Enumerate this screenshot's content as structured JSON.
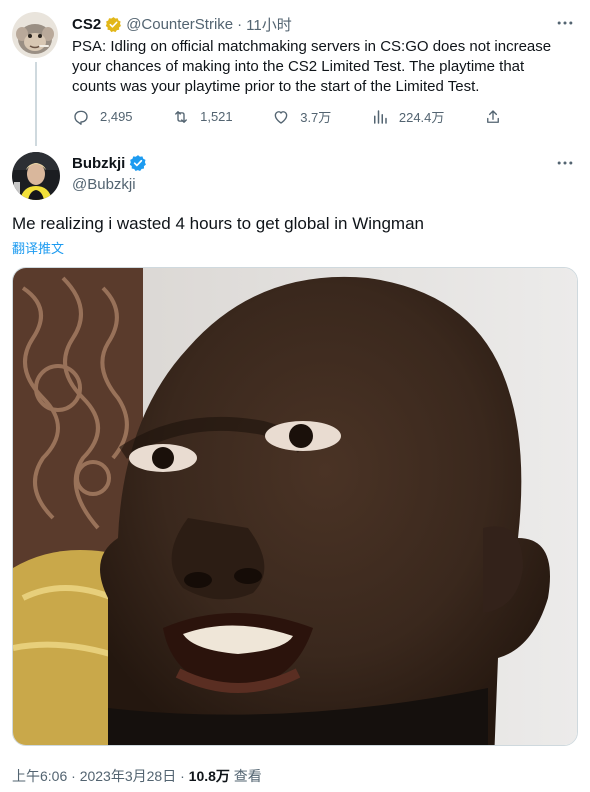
{
  "parent_tweet": {
    "name": "CS2",
    "handle": "@CounterStrike",
    "separator": "·",
    "time": "11小时",
    "text": "PSA: Idling on official matchmaking servers in CS:GO does not increase your chances of making into the CS2 Limited Test. The playtime that counts was your playtime prior to the start of the Limited Test.",
    "replies": "2,495",
    "retweets": "1,521",
    "likes": "3.7万",
    "views": "224.4万",
    "verified_badge_color": "#e2b719"
  },
  "main_tweet": {
    "name": "Bubzkji",
    "handle": "@Bubzkji",
    "text": "Me realizing i wasted 4 hours to get global in Wingman",
    "translate_label": "翻译推文",
    "verified_badge_color": "#1d9bf0",
    "timestamp": "上午6:06 · 2023年3月28日",
    "separator": "·",
    "view_count": "10.8万",
    "view_label": "查看"
  },
  "icons": [
    "more-icon",
    "reply-icon",
    "retweet-icon",
    "like-icon",
    "views-icon",
    "share-icon",
    "verified-icon"
  ],
  "colors": {
    "accent": "#1d9bf0",
    "muted": "#536471",
    "text": "#0f1419",
    "border": "#cfd9de"
  }
}
